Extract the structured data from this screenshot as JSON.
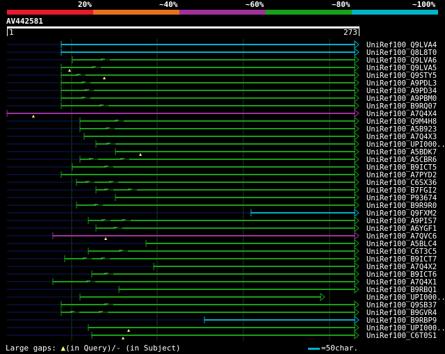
{
  "scale": {
    "labels": [
      "20%",
      "~40%",
      "~60%",
      "~80%",
      "~100%"
    ],
    "colors": [
      "#e8192c",
      "#e87020",
      "#a0309a",
      "#18a018",
      "#00b4c8"
    ]
  },
  "query": {
    "title": "AV442581",
    "start": "1",
    "end": "273"
  },
  "colors": {
    "identity_green": "#18a018",
    "identity_cyan": "#00b4c8",
    "identity_purple": "#a030a0",
    "unaligned": "#101860",
    "gap_marker": "#ffff80"
  },
  "hits": [
    {
      "label": "UniRef100_Q9LVA4",
      "color": "cyan",
      "start": 88,
      "gaps": [],
      "marker": null
    },
    {
      "label": "UniRef100_Q8L8T0",
      "color": "cyan",
      "start": 88,
      "gaps": [],
      "marker": null
    },
    {
      "label": "UniRef100_Q9LVA6",
      "color": "green",
      "start": 104,
      "gaps": [
        148
      ],
      "marker": null
    },
    {
      "label": "UniRef100_Q9LVA5",
      "color": "green",
      "start": 88,
      "gaps": [
        135
      ],
      "marker": 100
    },
    {
      "label": "UniRef100_Q9STY5",
      "color": "green",
      "start": 88,
      "gaps": [
        113
      ],
      "marker": 150
    },
    {
      "label": "UniRef100_A9PDL3",
      "color": "green",
      "start": 88,
      "gaps": [
        120
      ],
      "marker": null
    },
    {
      "label": "UniRef100_A9PD34",
      "color": "green",
      "start": 88,
      "gaps": [
        125
      ],
      "marker": null
    },
    {
      "label": "UniRef100_A9PBM0",
      "color": "green",
      "start": 88,
      "gaps": [
        120
      ],
      "marker": null
    },
    {
      "label": "UniRef100_B9RQ07",
      "color": "green",
      "start": 88,
      "gaps": [
        146
      ],
      "marker": null
    },
    {
      "label": "UniRef100_A7Q4X4",
      "color": "purple",
      "start": 10,
      "gaps": [],
      "marker": 48
    },
    {
      "label": "UniRef100_Q9M4H8",
      "color": "green",
      "start": 115,
      "gaps": [
        168
      ],
      "marker": null
    },
    {
      "label": "UniRef100_A5B923",
      "color": "green",
      "start": 115,
      "gaps": [
        155
      ],
      "marker": null
    },
    {
      "label": "UniRef100_A7Q4X3",
      "color": "green",
      "start": 121,
      "gaps": [],
      "marker": null
    },
    {
      "label": "UniRef100_UPI000..",
      "color": "green",
      "start": 138,
      "gaps": [
        156
      ],
      "marker": null
    },
    {
      "label": "UniRef100_A5BDK7",
      "color": "green",
      "start": 166,
      "gaps": [],
      "marker": 202
    },
    {
      "label": "UniRef100_A5CBR6",
      "color": "green",
      "start": 115,
      "gaps": [
        131,
        176
      ],
      "marker": null
    },
    {
      "label": "UniRef100_B9ICT5",
      "color": "green",
      "start": 104,
      "gaps": [
        153
      ],
      "marker": null
    },
    {
      "label": "UniRef100_A7PYD2",
      "color": "green",
      "start": 88,
      "gaps": [],
      "marker": null
    },
    {
      "label": "UniRef100_C6SX36",
      "color": "green",
      "start": 110,
      "gaps": [
        126,
        160
      ],
      "marker": null
    },
    {
      "label": "UniRef100_B7FGI2",
      "color": "green",
      "start": 138,
      "gaps": [
        153,
        187
      ],
      "marker": null
    },
    {
      "label": "UniRef100_P93674",
      "color": "green",
      "start": 166,
      "gaps": [],
      "marker": null
    },
    {
      "label": "UniRef100_B9R9R0",
      "color": "green",
      "start": 110,
      "gaps": [
        138
      ],
      "marker": null
    },
    {
      "label": "UniRef100_Q9FXM2",
      "color": "cyan",
      "start": 361,
      "gaps": [],
      "marker": null
    },
    {
      "label": "UniRef100_A9PIS7",
      "color": "green",
      "start": 127,
      "gaps": [
        149,
        178
      ],
      "marker": null
    },
    {
      "label": "UniRef100_A6YGF1",
      "color": "green",
      "start": 138,
      "gaps": [
        166
      ],
      "marker": null
    },
    {
      "label": "UniRef100_A7QVC6",
      "color": "purple",
      "start": 76,
      "gaps": [],
      "marker": 152
    },
    {
      "label": "UniRef100_A5BLC4",
      "color": "green",
      "start": 210,
      "gaps": [],
      "marker": null
    },
    {
      "label": "UniRef100_C6T3C5",
      "color": "green",
      "start": 127,
      "gaps": [
        174
      ],
      "marker": null
    },
    {
      "label": "UniRef100_B9ICT7",
      "color": "green",
      "start": 93,
      "gaps": [
        122,
        148
      ],
      "marker": null
    },
    {
      "label": "UniRef100_A7Q4X2",
      "color": "green",
      "start": 221,
      "gaps": [],
      "marker": null
    },
    {
      "label": "UniRef100_B9ICT6",
      "color": "green",
      "start": 132,
      "gaps": [
        153
      ],
      "marker": null
    },
    {
      "label": "UniRef100_A7Q4X1",
      "color": "green",
      "start": 76,
      "gaps": [
        127
      ],
      "marker": null
    },
    {
      "label": "UniRef100_B9RBQ1",
      "color": "green",
      "start": 171,
      "gaps": [],
      "marker": null
    },
    {
      "label": "UniRef100_UPI000..",
      "color": "green",
      "start": 115,
      "gaps": [],
      "marker": null,
      "short": 467
    },
    {
      "label": "UniRef100_Q9SB37",
      "color": "green",
      "start": 88,
      "gaps": [
        153
      ],
      "marker": null
    },
    {
      "label": "UniRef100_B9GVR4",
      "color": "green",
      "start": 88,
      "gaps": [
        104,
        145
      ],
      "marker": null
    },
    {
      "label": "UniRef100_B9RBP9",
      "color": "cyan",
      "start": 294,
      "gaps": [],
      "marker": null
    },
    {
      "label": "UniRef100_UPI000..",
      "color": "green",
      "start": 127,
      "gaps": [],
      "marker": 185
    },
    {
      "label": "UniRef100_C6T0S1",
      "color": "green",
      "start": 132,
      "gaps": [],
      "marker": 177
    }
  ],
  "legend": {
    "gaps_prefix": "Large gaps: ",
    "gaps_query": "(in Query)/- (in Subject)",
    "scale_text": "=50char."
  }
}
